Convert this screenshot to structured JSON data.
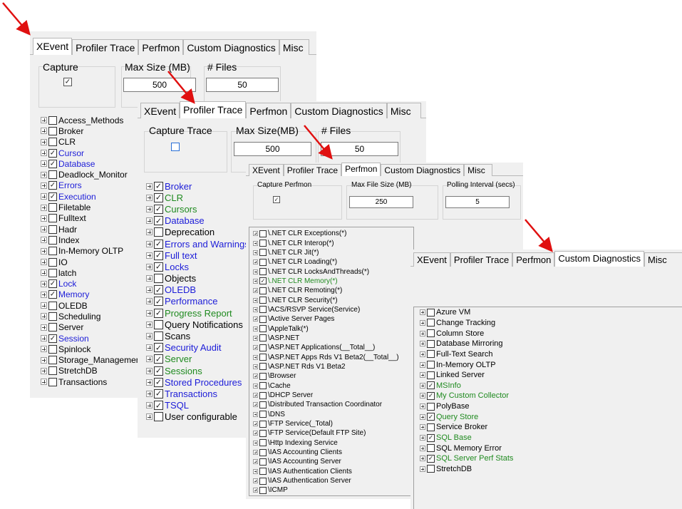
{
  "tabs": [
    "XEvent",
    "Profiler Trace",
    "Perfmon",
    "Custom Diagnostics",
    "Misc"
  ],
  "panels": {
    "xevent": {
      "active_tab": 0,
      "capture_label": "Capture",
      "capture_checked": true,
      "max_size_label": "Max Size (MB)",
      "max_size_value": "500",
      "files_label": "# Files",
      "files_value": "50",
      "items": [
        {
          "label": "Access_Methods",
          "checked": false,
          "color": "black"
        },
        {
          "label": "Broker",
          "checked": false,
          "color": "black"
        },
        {
          "label": "CLR",
          "checked": false,
          "color": "black"
        },
        {
          "label": "Cursor",
          "checked": true,
          "color": "blue"
        },
        {
          "label": "Database",
          "checked": true,
          "color": "blue"
        },
        {
          "label": "Deadlock_Monitor",
          "checked": false,
          "color": "black"
        },
        {
          "label": "Errors",
          "checked": true,
          "color": "blue"
        },
        {
          "label": "Execution",
          "checked": true,
          "color": "blue"
        },
        {
          "label": "Filetable",
          "checked": false,
          "color": "black"
        },
        {
          "label": "Fulltext",
          "checked": false,
          "color": "black"
        },
        {
          "label": "Hadr",
          "checked": false,
          "color": "black"
        },
        {
          "label": "Index",
          "checked": false,
          "color": "black"
        },
        {
          "label": "In-Memory OLTP",
          "checked": false,
          "color": "black"
        },
        {
          "label": "IO",
          "checked": false,
          "color": "black"
        },
        {
          "label": "latch",
          "checked": false,
          "color": "black"
        },
        {
          "label": "Lock",
          "checked": true,
          "color": "blue"
        },
        {
          "label": "Memory",
          "checked": true,
          "color": "blue"
        },
        {
          "label": "OLEDB",
          "checked": false,
          "color": "black"
        },
        {
          "label": "Scheduling",
          "checked": false,
          "color": "black"
        },
        {
          "label": "Server",
          "checked": false,
          "color": "black"
        },
        {
          "label": "Session",
          "checked": true,
          "color": "blue"
        },
        {
          "label": "Spinlock",
          "checked": false,
          "color": "black"
        },
        {
          "label": "Storage_Management",
          "checked": false,
          "color": "black"
        },
        {
          "label": "StretchDB",
          "checked": false,
          "color": "black"
        },
        {
          "label": "Transactions",
          "checked": false,
          "color": "black"
        }
      ]
    },
    "profiler": {
      "active_tab": 1,
      "capture_label": "Capture Trace",
      "capture_checked": false,
      "max_size_label": "Max Size(MB)",
      "max_size_value": "500",
      "files_label": "# Files",
      "files_value": "50",
      "items": [
        {
          "label": "Broker",
          "checked": true,
          "color": "blue"
        },
        {
          "label": "CLR",
          "checked": true,
          "color": "green"
        },
        {
          "label": "Cursors",
          "checked": true,
          "color": "green"
        },
        {
          "label": "Database",
          "checked": true,
          "color": "blue"
        },
        {
          "label": "Deprecation",
          "checked": false,
          "color": "black"
        },
        {
          "label": "Errors and Warnings",
          "checked": true,
          "color": "blue"
        },
        {
          "label": "Full text",
          "checked": true,
          "color": "blue"
        },
        {
          "label": "Locks",
          "checked": true,
          "color": "blue"
        },
        {
          "label": "Objects",
          "checked": false,
          "color": "black"
        },
        {
          "label": "OLEDB",
          "checked": true,
          "color": "blue"
        },
        {
          "label": "Performance",
          "checked": true,
          "color": "blue"
        },
        {
          "label": "Progress Report",
          "checked": true,
          "color": "green"
        },
        {
          "label": "Query Notifications",
          "checked": false,
          "color": "black"
        },
        {
          "label": "Scans",
          "checked": false,
          "color": "black"
        },
        {
          "label": "Security Audit",
          "checked": true,
          "color": "blue"
        },
        {
          "label": "Server",
          "checked": true,
          "color": "green"
        },
        {
          "label": "Sessions",
          "checked": true,
          "color": "green"
        },
        {
          "label": "Stored Procedures",
          "checked": true,
          "color": "blue"
        },
        {
          "label": "Transactions",
          "checked": true,
          "color": "blue"
        },
        {
          "label": "TSQL",
          "checked": true,
          "color": "blue"
        },
        {
          "label": "User configurable",
          "checked": false,
          "color": "black"
        }
      ]
    },
    "perfmon": {
      "active_tab": 2,
      "capture_label": "Capture Perfmon",
      "capture_checked": true,
      "max_file_label": "Max File Size (MB)",
      "max_file_value": "250",
      "polling_label": "Polling Interval (secs)",
      "polling_value": "5",
      "items": [
        {
          "label": "\\.NET CLR Exceptions(*)",
          "checked": false,
          "color": "black"
        },
        {
          "label": "\\.NET CLR Interop(*)",
          "checked": false,
          "color": "black"
        },
        {
          "label": "\\.NET CLR Jit(*)",
          "checked": false,
          "color": "black"
        },
        {
          "label": "\\.NET CLR Loading(*)",
          "checked": false,
          "color": "black"
        },
        {
          "label": "\\.NET CLR LocksAndThreads(*)",
          "checked": false,
          "color": "black"
        },
        {
          "label": "\\.NET CLR Memory(*)",
          "checked": true,
          "color": "green"
        },
        {
          "label": "\\.NET CLR Remoting(*)",
          "checked": false,
          "color": "black"
        },
        {
          "label": "\\.NET CLR Security(*)",
          "checked": false,
          "color": "black"
        },
        {
          "label": "\\ACS/RSVP Service(Service)",
          "checked": false,
          "color": "black"
        },
        {
          "label": "\\Active Server Pages",
          "checked": false,
          "color": "black"
        },
        {
          "label": "\\AppleTalk(*)",
          "checked": false,
          "color": "black"
        },
        {
          "label": "\\ASP.NET",
          "checked": false,
          "color": "black"
        },
        {
          "label": "\\ASP.NET Applications(__Total__)",
          "checked": false,
          "color": "black"
        },
        {
          "label": "\\ASP.NET Apps Rds V1 Beta2(__Total__)",
          "checked": false,
          "color": "black"
        },
        {
          "label": "\\ASP.NET Rds V1 Beta2",
          "checked": false,
          "color": "black"
        },
        {
          "label": "\\Browser",
          "checked": false,
          "color": "black"
        },
        {
          "label": "\\Cache",
          "checked": false,
          "color": "black"
        },
        {
          "label": "\\DHCP Server",
          "checked": false,
          "color": "black"
        },
        {
          "label": "\\Distributed Transaction Coordinator",
          "checked": false,
          "color": "black"
        },
        {
          "label": "\\DNS",
          "checked": false,
          "color": "black"
        },
        {
          "label": "\\FTP Service(_Total)",
          "checked": false,
          "color": "black"
        },
        {
          "label": "\\FTP Service(Default FTP Site)",
          "checked": false,
          "color": "black"
        },
        {
          "label": "\\Http Indexing Service",
          "checked": false,
          "color": "black"
        },
        {
          "label": "\\IAS Accounting Clients",
          "checked": false,
          "color": "black"
        },
        {
          "label": "\\IAS Accounting Server",
          "checked": false,
          "color": "black"
        },
        {
          "label": "\\IAS Authentication Clients",
          "checked": false,
          "color": "black"
        },
        {
          "label": "\\IAS Authentication Server",
          "checked": false,
          "color": "black"
        },
        {
          "label": "\\ICMP",
          "checked": false,
          "color": "black"
        }
      ]
    },
    "custom": {
      "active_tab": 3,
      "items": [
        {
          "label": "Azure VM",
          "checked": false,
          "color": "black"
        },
        {
          "label": "Change Tracking",
          "checked": false,
          "color": "black"
        },
        {
          "label": "Column Store",
          "checked": false,
          "color": "black"
        },
        {
          "label": "Database Mirroring",
          "checked": false,
          "color": "black"
        },
        {
          "label": "Full-Text Search",
          "checked": false,
          "color": "black"
        },
        {
          "label": "In-Memory OLTP",
          "checked": false,
          "color": "black"
        },
        {
          "label": "Linked Server",
          "checked": false,
          "color": "black"
        },
        {
          "label": "MSInfo",
          "checked": true,
          "color": "green"
        },
        {
          "label": "My Custom Collector",
          "checked": true,
          "color": "green"
        },
        {
          "label": "PolyBase",
          "checked": false,
          "color": "black"
        },
        {
          "label": "Query Store",
          "checked": true,
          "color": "green"
        },
        {
          "label": "Service Broker",
          "checked": false,
          "color": "black"
        },
        {
          "label": "SQL Base",
          "checked": true,
          "color": "green"
        },
        {
          "label": "SQL Memory Error",
          "checked": false,
          "color": "black"
        },
        {
          "label": "SQL Server Perf Stats",
          "checked": true,
          "color": "green"
        },
        {
          "label": "StretchDB",
          "checked": false,
          "color": "black"
        }
      ]
    }
  },
  "colors": {
    "arrow": "#e01010",
    "blue_item": "#1c1cd8",
    "green_item": "#1f8a1f",
    "panel_bg": "#f0f0f0"
  }
}
